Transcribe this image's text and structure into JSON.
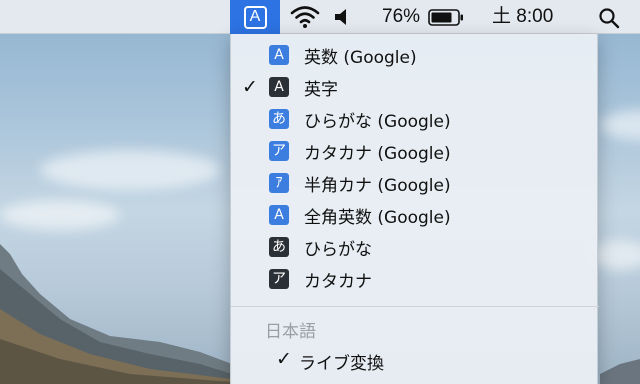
{
  "menubar": {
    "input_source_glyph": "A",
    "battery_percent": "76%",
    "clock": "土 8:00",
    "icons": [
      "input-source-icon",
      "wifi-icon",
      "volume-icon",
      "battery-icon",
      "spotlight-icon"
    ],
    "accent_color": "#2d73e3"
  },
  "menu": {
    "items": [
      {
        "icon_glyph": "A",
        "icon_style": "blue",
        "label": "英数 (Google)",
        "checked": false
      },
      {
        "icon_glyph": "A",
        "icon_style": "dark",
        "label": "英字",
        "checked": true
      },
      {
        "icon_glyph": "あ",
        "icon_style": "blue",
        "label": "ひらがな (Google)",
        "checked": false
      },
      {
        "icon_glyph": "ア",
        "icon_style": "blue",
        "label": "カタカナ (Google)",
        "checked": false
      },
      {
        "icon_glyph": "ｱ",
        "icon_style": "blue",
        "label": "半角カナ (Google)",
        "checked": false
      },
      {
        "icon_glyph": "A",
        "icon_style": "blue",
        "label": "全角英数 (Google)",
        "checked": false
      },
      {
        "icon_glyph": "あ",
        "icon_style": "dark",
        "label": "ひらがな",
        "checked": false
      },
      {
        "icon_glyph": "ア",
        "icon_style": "dark",
        "label": "カタカナ",
        "checked": false
      }
    ],
    "check_mark": "✓",
    "section_header": "日本語",
    "sub_items": [
      {
        "label": "ライブ変換",
        "checked": true
      }
    ]
  }
}
